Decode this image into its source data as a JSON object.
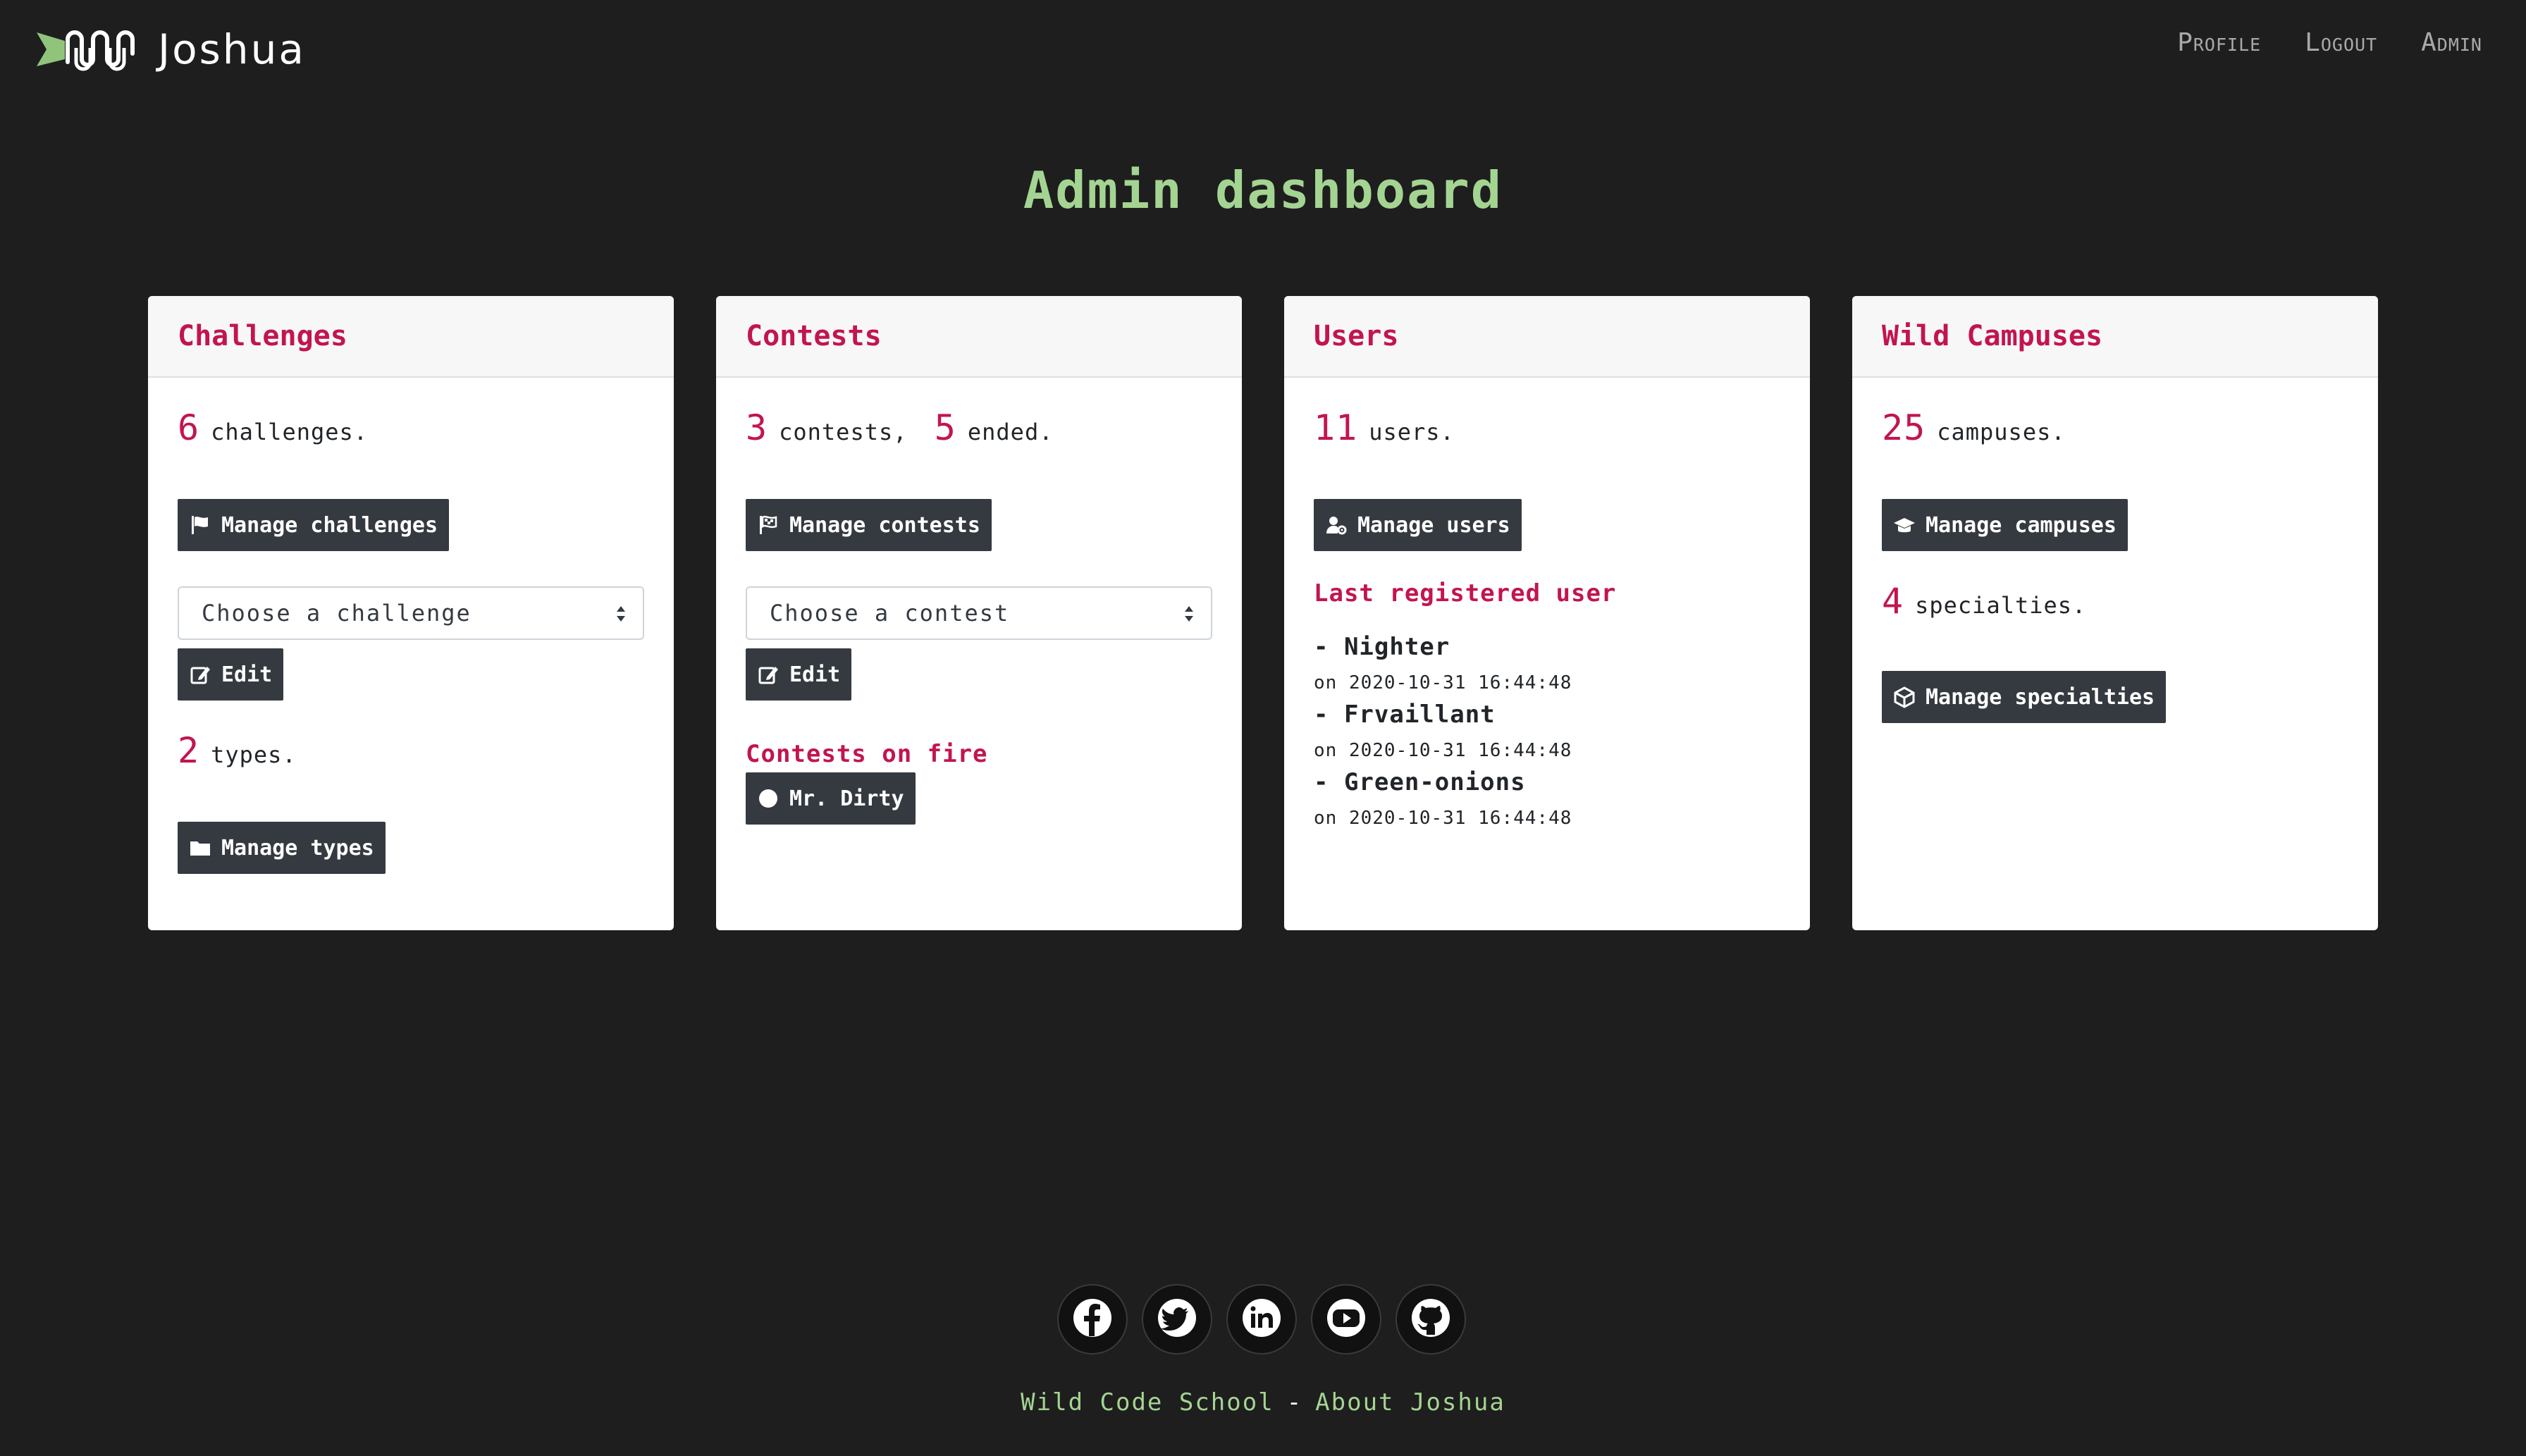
{
  "brand": {
    "name": "Joshua",
    "logo_icon": "wild-code-school-logo"
  },
  "nav": {
    "profile": "Profile",
    "logout": "Logout",
    "admin": "Admin"
  },
  "page": {
    "title": "Admin dashboard"
  },
  "colors": {
    "background": "#1e1e1e",
    "accent": "#c2154f",
    "title_green": "#a4d492",
    "button": "#343a40"
  },
  "cards": {
    "challenges": {
      "title": "Challenges",
      "count": "6",
      "count_text": "challenges.",
      "manage_label": "Manage challenges",
      "manage_icon": "flag-icon",
      "select_placeholder": "Choose a challenge",
      "edit_label": "Edit",
      "edit_icon": "edit-icon",
      "types_count": "2",
      "types_text": "types.",
      "types_label": "Manage types",
      "types_icon": "folder-icon"
    },
    "contests": {
      "title": "Contests",
      "count": "3",
      "count_text": "contests,",
      "ended_count": "5",
      "ended_text": "ended.",
      "manage_label": "Manage contests",
      "manage_icon": "checkered-flag-icon",
      "select_placeholder": "Choose a contest",
      "edit_label": "Edit",
      "edit_icon": "edit-icon",
      "on_fire_label": "Contests on fire",
      "on_fire_items": [
        "Mr. Dirty"
      ]
    },
    "users": {
      "title": "Users",
      "count": "11",
      "count_text": "users.",
      "manage_label": "Manage users",
      "manage_icon": "user-cog-icon",
      "last_registered_label": "Last registered user",
      "last_users": [
        {
          "name": "- Nighter",
          "date": "on 2020-10-31 16:44:48"
        },
        {
          "name": "- Frvaillant",
          "date": "on 2020-10-31 16:44:48"
        },
        {
          "name": "- Green-onions",
          "date": "on 2020-10-31 16:44:48"
        }
      ]
    },
    "campuses": {
      "title": "Wild Campuses",
      "count": "25",
      "count_text": "campuses.",
      "manage_label": "Manage campuses",
      "manage_icon": "graduation-cap-icon",
      "specialties_count": "4",
      "specialties_text": "specialties.",
      "specialties_label": "Manage specialties",
      "specialties_icon": "cube-icon"
    }
  },
  "footer": {
    "social": [
      "facebook-icon",
      "twitter-icon",
      "linkedin-icon",
      "youtube-icon",
      "github-icon"
    ],
    "school_link": "Wild Code School",
    "separator": "-",
    "about_link": "About Joshua"
  }
}
